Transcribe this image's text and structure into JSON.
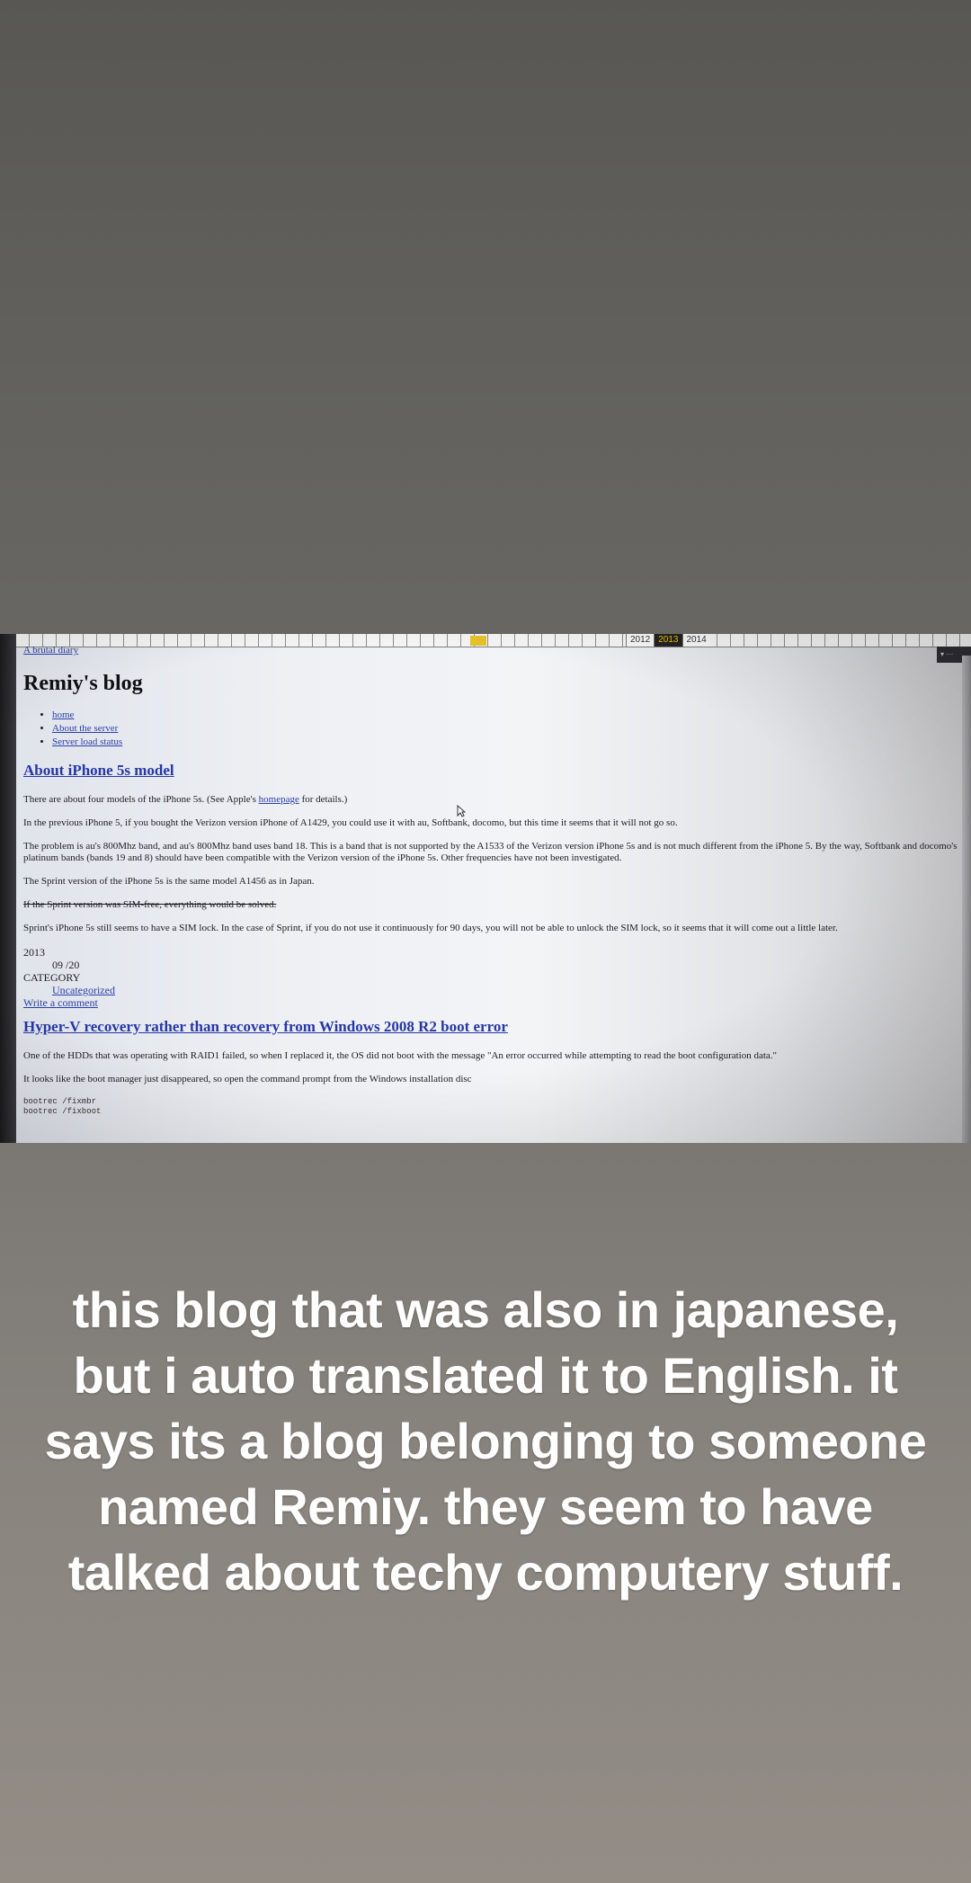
{
  "timeline": {
    "years": [
      "2012",
      "2013",
      "2014"
    ],
    "active_year": "2013"
  },
  "site": {
    "breadcrumb": "A brutal diary",
    "title": "Remiy's blog"
  },
  "nav": [
    "home",
    "About the server",
    "Server load status"
  ],
  "post1": {
    "title": "About iPhone 5s model",
    "p1_before": "There are about four models of the iPhone 5s. (See Apple's ",
    "p1_link": "homepage",
    "p1_after": " for details.)",
    "p2": "In the previous iPhone 5, if you bought the Verizon version iPhone of A1429, you could use it with au, Softbank, docomo, but this time it seems that it will not go so.",
    "p3": "The problem is au's 800Mhz band, and au's 800Mhz band uses band 18. This is a band that is not supported by the A1533 of the Verizon version iPhone 5s and is not much different from the iPhone 5. By the way, Softbank and docomo's platinum bands (bands 19 and 8) should have been compatible with the Verizon version of the iPhone 5s. Other frequencies have not been investigated.",
    "p4": "The Sprint version of the iPhone 5s is the same model A1456 as in Japan.",
    "p5_strike": "If the Sprint version was SIM-free, everything would be solved.",
    "p6": "Sprint's iPhone 5s still seems to have a SIM lock. In the case of Sprint, if you do not use it continuously for 90 days, you will not be able to unlock the SIM lock, so it seems that it will come out a little later.",
    "year": "2013",
    "date": "09 /20",
    "category_label": "CATEGORY",
    "category": "Uncategorized",
    "comment_link": "Write a comment"
  },
  "post2": {
    "title": "Hyper-V recovery rather than recovery from Windows 2008 R2 boot error",
    "p1": "One of the HDDs that was operating with RAID1 failed, so when I replaced it, the OS did not boot with the message \"An error occurred while attempting to read the boot configuration data.\"",
    "p2": "It looks like the boot manager just disappeared, so open the command prompt from the Windows installation disc",
    "code1": "bootrec /fixmbr",
    "code2": "bootrec /fixboot"
  },
  "caption": "this blog that was also in japanese, but i auto translated it to English. it says its a blog belonging to someone named Remiy. they seem to have talked about techy computery stuff.",
  "colors": {
    "link": "#2c3fa8",
    "caption": "#ffffff",
    "timeline_highlight": "#e6c12a"
  }
}
